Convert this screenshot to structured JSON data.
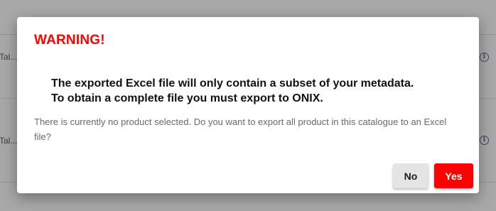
{
  "background": {
    "rows": [
      {
        "text": "Tal..."
      },
      {
        "text": "Tal..."
      }
    ]
  },
  "dialog": {
    "title": "WARNING!",
    "headline_line1": "The exported Excel file will only contain a subset of your metadata.",
    "headline_line2": "To obtain a complete file you must export to ONIX.",
    "message": "There is currently no product selected. Do you want to export all product in this catalogue to an Excel file?",
    "no_label": "No",
    "yes_label": "Yes"
  },
  "colors": {
    "warning": "#ff0000",
    "yes_button": "#ff0000",
    "no_button": "#e4e4e4"
  },
  "icons": [
    "info-icon"
  ]
}
